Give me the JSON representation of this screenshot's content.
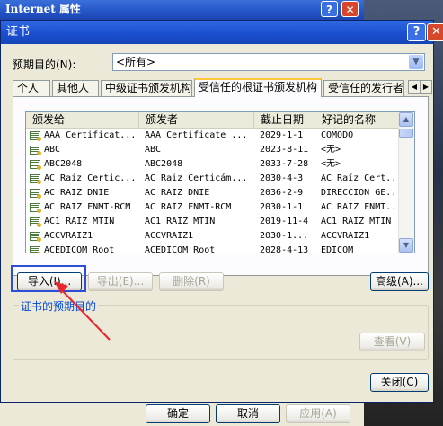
{
  "background_window": {
    "title": "Internet 属性",
    "help": "?",
    "close": "✕"
  },
  "dialog": {
    "title": "证书",
    "help": "?",
    "close": "✕",
    "purpose": {
      "label": "预期目的(N):",
      "value": "<所有>"
    },
    "tabs": [
      {
        "label": "个人"
      },
      {
        "label": "其他人"
      },
      {
        "label": "中级证书颁发机构"
      },
      {
        "label": "受信任的根证书颁发机构"
      },
      {
        "label": "受信任的发行者"
      }
    ],
    "list": {
      "columns": [
        "颁发给",
        "颁发者",
        "截止日期",
        "好记的名称"
      ],
      "rows": [
        {
          "issued_to": "AAA Certificat...",
          "issued_by": "AAA Certificate ...",
          "expiry": "2029-1-1",
          "friendly": "COMODO"
        },
        {
          "issued_to": "ABC",
          "issued_by": "ABC",
          "expiry": "2023-8-11",
          "friendly": "<无>"
        },
        {
          "issued_to": "ABC2048",
          "issued_by": "ABC2048",
          "expiry": "2033-7-28",
          "friendly": "<无>"
        },
        {
          "issued_to": "AC Raiz Certic...",
          "issued_by": "AC Raiz Certicám...",
          "expiry": "2030-4-3",
          "friendly": "AC Raíz Cert..."
        },
        {
          "issued_to": "AC RAIZ DNIE",
          "issued_by": "AC RAIZ DNIE",
          "expiry": "2036-2-9",
          "friendly": "DIRECCION GE..."
        },
        {
          "issued_to": "AC RAIZ FNMT-RCM",
          "issued_by": "AC RAIZ FNMT-RCM",
          "expiry": "2030-1-1",
          "friendly": "AC RAIZ FNMT..."
        },
        {
          "issued_to": "AC1 RAIZ MTIN",
          "issued_by": "AC1 RAIZ MTIN",
          "expiry": "2019-11-4",
          "friendly": "AC1 RAIZ MTIN"
        },
        {
          "issued_to": "ACCVRAIZ1",
          "issued_by": "ACCVRAIZ1",
          "expiry": "2030-1...",
          "friendly": "ACCVRAIZ1"
        },
        {
          "issued_to": "ACEDICOM Root",
          "issued_by": "ACEDICOM Root",
          "expiry": "2028-4-13",
          "friendly": "EDICOM"
        }
      ]
    },
    "buttons": {
      "import": "导入(I)...",
      "export": "导出(E)...",
      "remove": "删除(R)",
      "advanced": "高级(A)...",
      "view": "查看(V)",
      "close": "关闭(C)"
    },
    "group_title": "证书的预期目的"
  },
  "bottom_buttons": {
    "ok": "确定",
    "cancel": "取消",
    "apply": "应用(A)"
  },
  "colors": {
    "highlight_box": "#2d4fd8",
    "annotation_arrow": "#e8262d",
    "titlebar": "#1a4fd0"
  },
  "icons": [
    "help-icon",
    "close-icon",
    "dropdown-arrow-icon",
    "certificate-icon",
    "scroll-up-icon",
    "scroll-down-icon",
    "tab-scroll-left-icon",
    "tab-scroll-right-icon"
  ]
}
